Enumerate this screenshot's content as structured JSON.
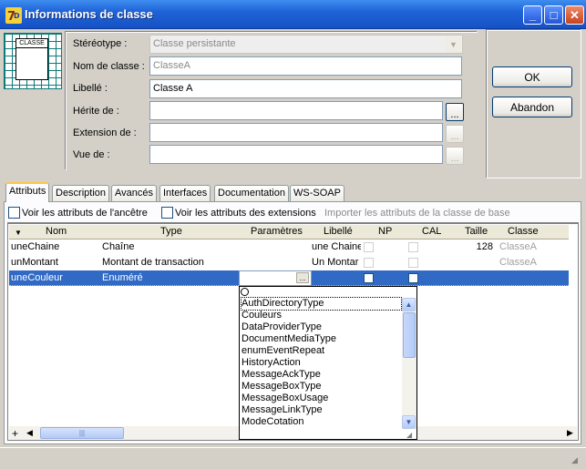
{
  "window": {
    "title": "Informations de classe",
    "minimize_glyph": "_",
    "maximize_glyph": "□",
    "close_glyph": "✕"
  },
  "class_icon": {
    "caption": "CLASSE"
  },
  "form": {
    "stereotype": {
      "label": "Stéréotype :",
      "value": "Classe persistante"
    },
    "class_name": {
      "label": "Nom de classe :",
      "value": "ClasseA"
    },
    "caption": {
      "label": "Libellé :",
      "value": "Classe A"
    },
    "inherits": {
      "label": "Hérite de :",
      "value": ""
    },
    "extension": {
      "label": "Extension de :",
      "value": ""
    },
    "view": {
      "label": "Vue de :",
      "value": ""
    },
    "browse_glyph": "..."
  },
  "buttons": {
    "ok": "OK",
    "cancel": "Abandon"
  },
  "tabs": [
    "Attributs",
    "Description",
    "Avancés",
    "Interfaces",
    "Documentation",
    "WS-SOAP"
  ],
  "options": {
    "show_ancestor": "Voir les attributs de l'ancêtre",
    "show_extensions": "Voir les attributs des extensions",
    "import_base": "Importer les attributs de la classe de base"
  },
  "grid": {
    "columns": [
      "Nom",
      "Type",
      "Paramètres",
      "Libellé",
      "NP",
      "CAL",
      "Taille",
      "Classe"
    ],
    "rows": [
      {
        "name": "uneChaine",
        "type": "Chaîne",
        "params": "",
        "caption": "une Chaine",
        "size": "128",
        "class": "ClasseA"
      },
      {
        "name": "unMontant",
        "type": "Montant de transaction",
        "params": "",
        "caption": "Un Montar",
        "size": "",
        "class": "ClasseA"
      },
      {
        "name": "uneCouleur",
        "type": "Enuméré",
        "params": "",
        "caption": "",
        "size": "",
        "class": ""
      }
    ],
    "add_glyph": "+"
  },
  "dropdown": {
    "items": [
      "AuthDirectoryType",
      "Couleurs",
      "DataProviderType",
      "DocumentMediaType",
      "enumEventRepeat",
      "HistoryAction",
      "MessageAckType",
      "MessageBoxType",
      "MessageBoxUsage",
      "MessageLinkType",
      "ModeCotation"
    ],
    "up_glyph": "▲",
    "down_glyph": "▼"
  }
}
